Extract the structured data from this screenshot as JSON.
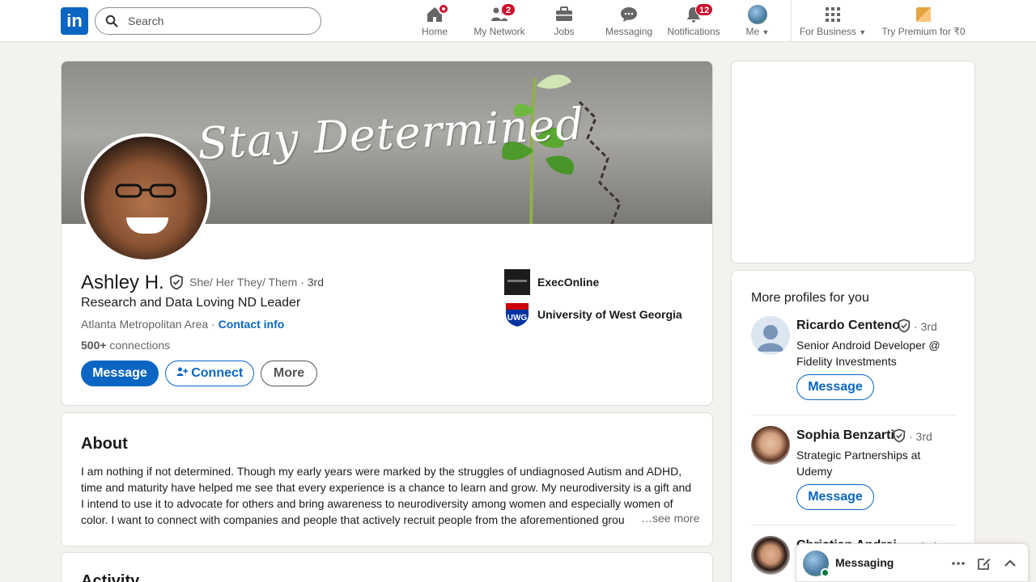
{
  "nav": {
    "logo": "in",
    "search_placeholder": "Search",
    "items": [
      {
        "label": "Home"
      },
      {
        "label": "My Network",
        "badge": "2"
      },
      {
        "label": "Jobs"
      },
      {
        "label": "Messaging"
      },
      {
        "label": "Notifications",
        "badge": "12"
      },
      {
        "label": "Me"
      },
      {
        "label": "For Business"
      },
      {
        "label": "Try Premium for ₹0"
      }
    ]
  },
  "profile": {
    "banner_text": "Stay Determined",
    "name": "Ashley H.",
    "pronouns": "She/ Her They/ Them",
    "degree": " · 3rd",
    "headline": "Research and Data Loving ND Leader",
    "location": "Atlanta Metropolitan Area · ",
    "contact_info": "Contact info",
    "connections_count": "500+",
    "connections_label": " connections",
    "buttons": {
      "message": "Message",
      "connect": "Connect",
      "more": "More"
    },
    "experience": [
      {
        "name": "ExecOnline"
      },
      {
        "name": "University of West Georgia",
        "logo_text": "UWG"
      }
    ]
  },
  "about": {
    "title": "About",
    "text": "I am nothing if not determined. Though my early years were marked by the struggles of undiagnosed Autism and ADHD, time and maturity have helped me see that every experience is a chance to learn and grow. My neurodiversity is a gift and I intend to use it to advocate for others and bring awareness to neurodiversity among women and especially women of color. I want to connect with companies and people that actively recruit people from the aforementioned grou",
    "see_more": "…see more"
  },
  "activity": {
    "title": "Activity"
  },
  "sidebar": {
    "more_profiles_title": "More profiles for you",
    "people": [
      {
        "name": "Ricardo Centeno",
        "degree": "· 3rd",
        "description": "Senior Android Developer @ Fidelity Investments",
        "button": "Message"
      },
      {
        "name": "Sophia Benzarti",
        "degree": "· 3rd",
        "description": "Strategic Partnerships at Udemy",
        "button": "Message"
      },
      {
        "name": "Christian Andrei",
        "degree": "· 3rd"
      }
    ]
  },
  "messaging": {
    "title": "Messaging"
  },
  "colors": {
    "brand": "#0a66c2",
    "badge": "#cb112d",
    "online": "#057642"
  }
}
